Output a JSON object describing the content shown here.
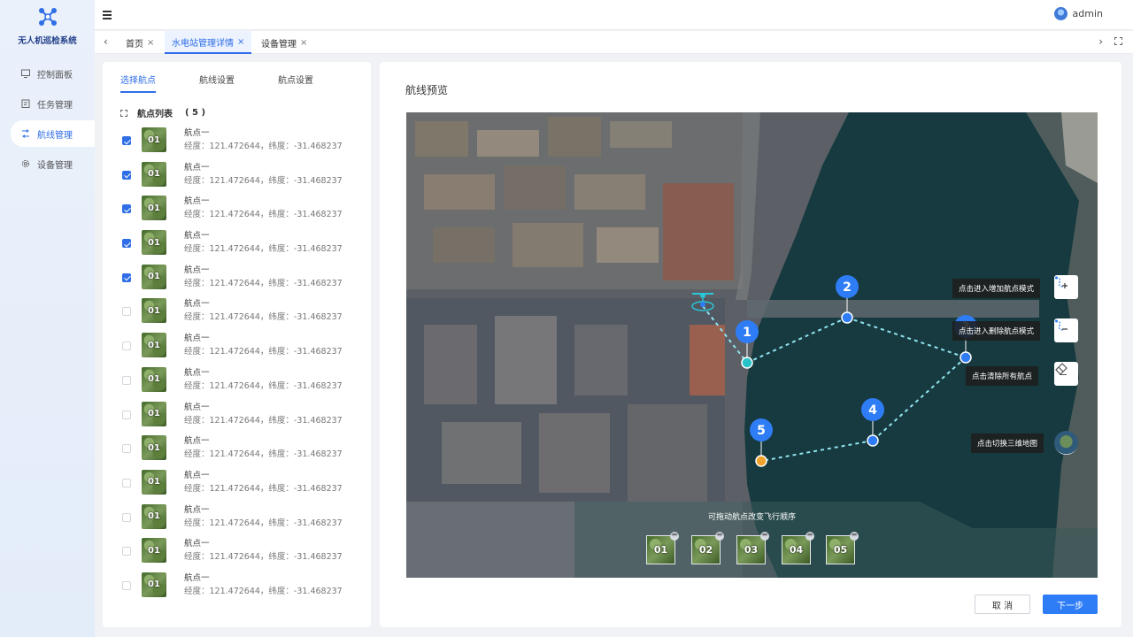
{
  "app": {
    "title": "无人机巡检系统"
  },
  "sidebar": {
    "items": [
      {
        "label": "控制面板",
        "icon": "monitor-icon"
      },
      {
        "label": "任务管理",
        "icon": "clipboard-icon"
      },
      {
        "label": "航线管理",
        "icon": "route-icon",
        "active": true
      },
      {
        "label": "设备管理",
        "icon": "gear-icon"
      }
    ]
  },
  "header": {
    "user": "admin"
  },
  "tabs": {
    "items": [
      {
        "label": "首页",
        "closable": true
      },
      {
        "label": "水电站管理详情",
        "closable": true,
        "active": true
      },
      {
        "label": "设备管理",
        "closable": true
      }
    ],
    "close_glyph": "×"
  },
  "left": {
    "subtabs": [
      "选择航点",
      "航线设置",
      "航点设置"
    ],
    "list_title": "航点列表",
    "list_count": "( 5 )",
    "waypoints": [
      {
        "badge": "01",
        "name": "航点一",
        "coords": "经度：121.472644，纬度：-31.468237",
        "checked": true
      },
      {
        "badge": "01",
        "name": "航点一",
        "coords": "经度：121.472644，纬度：-31.468237",
        "checked": true
      },
      {
        "badge": "01",
        "name": "航点一",
        "coords": "经度：121.472644，纬度：-31.468237",
        "checked": true
      },
      {
        "badge": "01",
        "name": "航点一",
        "coords": "经度：121.472644，纬度：-31.468237",
        "checked": true
      },
      {
        "badge": "01",
        "name": "航点一",
        "coords": "经度：121.472644，纬度：-31.468237",
        "checked": true
      },
      {
        "badge": "01",
        "name": "航点一",
        "coords": "经度：121.472644，纬度：-31.468237",
        "checked": false
      },
      {
        "badge": "01",
        "name": "航点一",
        "coords": "经度：121.472644，纬度：-31.468237",
        "checked": false
      },
      {
        "badge": "01",
        "name": "航点一",
        "coords": "经度：121.472644，纬度：-31.468237",
        "checked": false
      },
      {
        "badge": "01",
        "name": "航点一",
        "coords": "经度：121.472644，纬度：-31.468237",
        "checked": false
      },
      {
        "badge": "01",
        "name": "航点一",
        "coords": "经度：121.472644，纬度：-31.468237",
        "checked": false
      },
      {
        "badge": "01",
        "name": "航点一",
        "coords": "经度：121.472644，纬度：-31.468237",
        "checked": false
      },
      {
        "badge": "01",
        "name": "航点一",
        "coords": "经度：121.472644，纬度：-31.468237",
        "checked": false
      },
      {
        "badge": "01",
        "name": "航点一",
        "coords": "经度：121.472644，纬度：-31.468237",
        "checked": false
      },
      {
        "badge": "01",
        "name": "航点一",
        "coords": "经度：121.472644，纬度：-31.468237",
        "checked": false
      }
    ]
  },
  "right": {
    "title": "航线预览",
    "map": {
      "markers": [
        "1",
        "2",
        "3",
        "4",
        "5"
      ],
      "tooltips": {
        "add": "点击进入增加航点模式",
        "delete": "点击进入删除航点模式",
        "clear": "点击清除所有航点",
        "switch3d": "点击切换三维地图"
      },
      "strip_label": "可拖动航点改变飞行顺序",
      "strip": [
        "01",
        "02",
        "03",
        "04",
        "05"
      ],
      "route_color": "#8fe3ee",
      "marker_color": "#2f7df6",
      "start_color": "#27c3c9",
      "end_color": "#f0a32a"
    },
    "buttons": {
      "cancel": "取 消",
      "next": "下一步"
    }
  }
}
